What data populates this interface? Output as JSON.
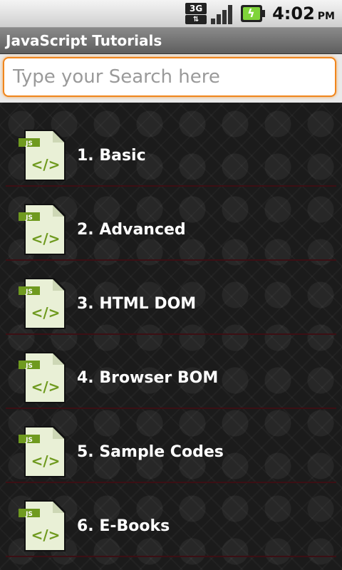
{
  "status_bar": {
    "network_label": "3G",
    "time": "4:02",
    "ampm": "PM",
    "icons": [
      "3g-data-icon",
      "signal-strength-icon",
      "battery-charging-icon"
    ]
  },
  "title_bar": {
    "title": "JavaScript Tutorials"
  },
  "search": {
    "placeholder": "Type your Search here",
    "value": ""
  },
  "list": {
    "icon_badge": "JS",
    "icon_glyph": "</>",
    "items": [
      {
        "label": "1. Basic"
      },
      {
        "label": "2. Advanced"
      },
      {
        "label": "3. HTML DOM"
      },
      {
        "label": "4. Browser BOM"
      },
      {
        "label": "5. Sample Codes"
      },
      {
        "label": "6. E-Books"
      }
    ]
  },
  "colors": {
    "accent_orange": "#f0861d",
    "divider": "#3c0f14",
    "icon_green": "#6f9a1f"
  }
}
